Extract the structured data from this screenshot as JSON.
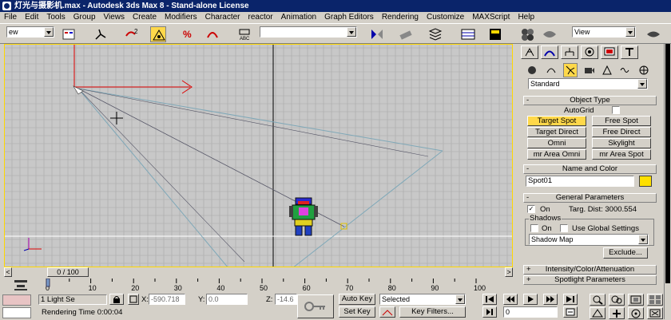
{
  "window": {
    "title": "灯光与摄影机.max - Autodesk 3ds Max 8 - Stand-alone License"
  },
  "menu": [
    "File",
    "Edit",
    "Tools",
    "Group",
    "Views",
    "Create",
    "Modifiers",
    "Character",
    "reactor",
    "Animation",
    "Graph Editors",
    "Rendering",
    "Customize",
    "MAXScript",
    "Help"
  ],
  "toolbar": {
    "selection_filter": "ew",
    "named_selection": "",
    "view_combo": "View"
  },
  "viewport": {
    "border_color": "#ffd800",
    "grid_color": "#a8a8a8"
  },
  "timeline": {
    "frame_label": "0 / 100"
  },
  "ruler": {
    "ticks": [
      "0",
      "10",
      "20",
      "30",
      "40",
      "50",
      "60",
      "70",
      "80",
      "90",
      "100"
    ]
  },
  "status": {
    "selection_info": "1 Light Se",
    "x_label": "X:",
    "x_value": "-590.718",
    "y_label": "Y:",
    "y_value": "0.0",
    "z_label": "Z:",
    "z_value": "-14.6",
    "prompt": "Rendering Time  0:00:04",
    "auto_key": "Auto Key",
    "set_key": "Set Key",
    "selected_combo": "Selected",
    "key_filters": "Key Filters...",
    "frame_value": "0"
  },
  "command_panel": {
    "category_combo": "Standard",
    "object_type": {
      "header": "Object Type",
      "autogrid": "AutoGrid",
      "buttons": [
        "Target Spot",
        "Free Spot",
        "Target Direct",
        "Free Direct",
        "Omni",
        "Skylight",
        "mr Area Omni",
        "mr Area Spot"
      ]
    },
    "name_color": {
      "header": "Name and Color",
      "name": "Spot01",
      "color": "#ffe000"
    },
    "general": {
      "header": "General Parameters",
      "on_label": "On",
      "targ_dist": "Targ. Dist: 3000.554",
      "shadows_label": "Shadows",
      "shadow_on": "On",
      "use_global": "Use Global Settings",
      "shadow_type": "Shadow Map",
      "exclude": "Exclude..."
    },
    "collapsed": [
      "Intensity/Color/Attenuation",
      "Spotlight Parameters"
    ]
  }
}
